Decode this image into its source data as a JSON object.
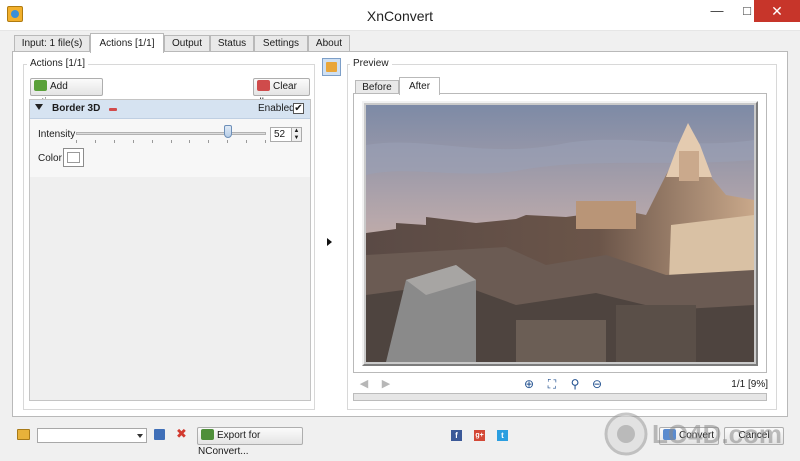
{
  "window": {
    "title": "XnConvert",
    "minimize": "—",
    "maximize": "□",
    "close": "✕"
  },
  "tabs": [
    {
      "label": "Input: 1 file(s)"
    },
    {
      "label": "Actions [1/1]"
    },
    {
      "label": "Output"
    },
    {
      "label": "Status"
    },
    {
      "label": "Settings"
    },
    {
      "label": "About"
    }
  ],
  "actions_panel": {
    "group_label": "Actions [1/1]",
    "add_action_label": "Add action>",
    "clear_all_label": "Clear all",
    "action": {
      "name": "Border 3D",
      "enabled_label": "Enabled",
      "enabled": true,
      "intensity_label": "Intensity",
      "intensity_value": "52",
      "intensity_fraction": 0.8,
      "color_label": "Color",
      "color_value": "#ffffff"
    }
  },
  "preview": {
    "group_label": "Preview",
    "tab_before": "Before",
    "tab_after": "After",
    "page_info": "1/1 [9%]"
  },
  "icons": {
    "prev": "◀",
    "next": "▶",
    "zoom_in": "⊕",
    "fit": "⛶",
    "zoom": "⚲",
    "zoom_out": "⊖",
    "expand": "▶"
  },
  "bottom_bar": {
    "export_label": "Export for NConvert...",
    "convert_label": "Convert",
    "cancel_label": "Cancel",
    "profile_value": ""
  },
  "social": {
    "facebook": "f",
    "googleplus": "g+",
    "twitter": "t"
  },
  "watermark": "LO4D.com",
  "colors": {
    "accent": "#d6e3f1",
    "close": "#c7352a",
    "selected_tab": "#ffffff"
  }
}
